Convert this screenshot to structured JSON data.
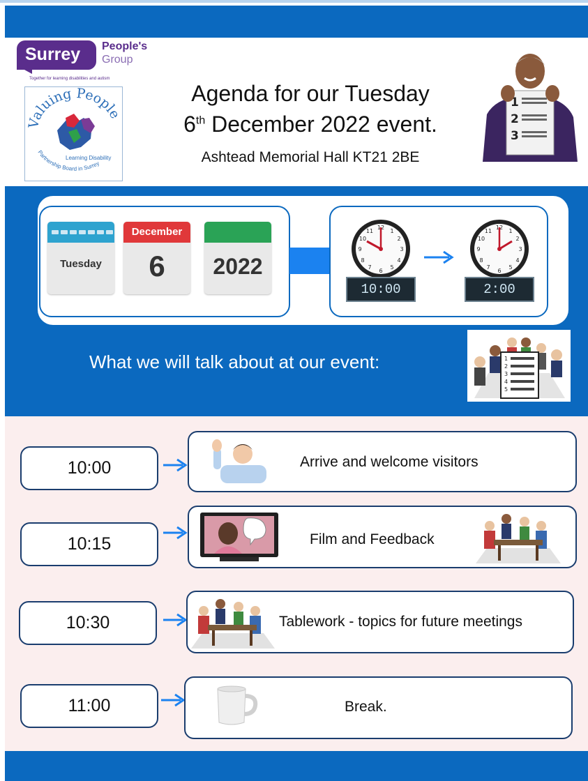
{
  "header": {
    "logo_surrey": "Surrey",
    "logo_peoples": "People's",
    "logo_group": "Group",
    "logo_tagline": "Together for learning disabilities and autism",
    "logo_vp_title": "Valuing People",
    "logo_vp_sub1": "Learning Disability",
    "logo_vp_sub2": "Partnership Board in Surrey",
    "title_line1": "Agenda for our Tuesday",
    "title_day": "6",
    "title_suffix": "th",
    "title_rest": " December 2022 event.",
    "venue": "Ashtead Memorial Hall KT21 2BE"
  },
  "date_panel": {
    "day_name": "Tuesday",
    "month": "December",
    "day_number": "6",
    "year": "2022",
    "start_time": "10:00",
    "end_time": "2:00"
  },
  "section_heading": "What we will talk about at our event:",
  "agenda": [
    {
      "time": "10:00",
      "label": "Arrive and welcome visitors",
      "icon": "waving-person-icon"
    },
    {
      "time": "10:15",
      "label": "Film and Feedback",
      "icon": "video-tv-icon"
    },
    {
      "time": "10:30",
      "label": "Tablework - topics for future meetings",
      "icon": "table-group-icon"
    },
    {
      "time": "11:00",
      "label": "Break.",
      "icon": "mug-icon"
    }
  ],
  "colors": {
    "band_blue": "#0b69bf",
    "agenda_background": "#fbeeee",
    "arrow_blue": "#1b82f0",
    "logo_purple": "#5a2d8c"
  }
}
